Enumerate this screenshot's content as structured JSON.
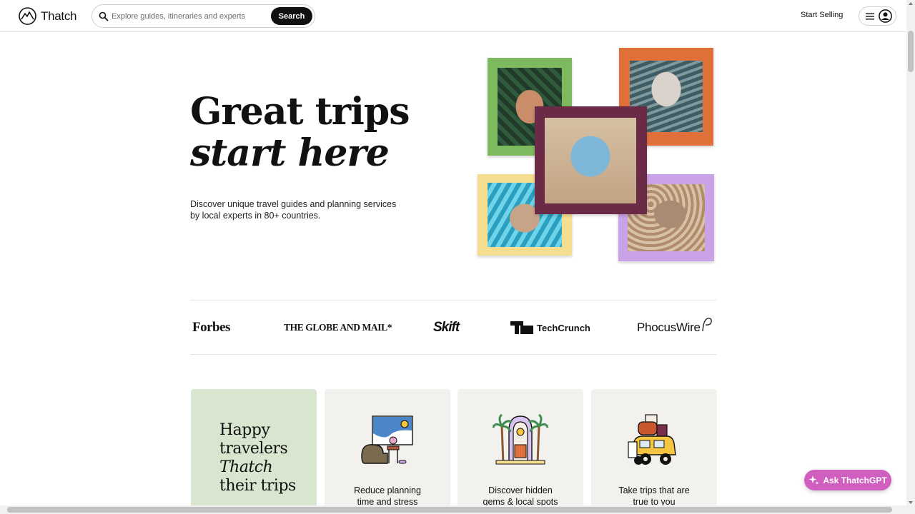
{
  "header": {
    "brand": "Thatch",
    "search_placeholder": "Explore guides, itineraries and experts",
    "search_button": "Search",
    "start_selling": "Start Selling",
    "icons": [
      "thatch-logo-icon",
      "search-icon",
      "hamburger-icon",
      "account-icon"
    ]
  },
  "hero": {
    "title_line1": "Great trips",
    "title_line2": "start here",
    "subtitle_line1": "Discover unique travel guides and planning services",
    "subtitle_line2": "by local experts in 80+ countries.",
    "photo_frame_colors": [
      "#7db95e",
      "#e0703a",
      "#6b2a45",
      "#f5de8f",
      "#c9a2e8"
    ]
  },
  "press": {
    "logos": [
      "Forbes",
      "THE GLOBE AND MAIL*",
      "Skift",
      "TechCrunch",
      "PhocusWire"
    ]
  },
  "features": {
    "lead": {
      "line1": "Happy",
      "line2": "travelers",
      "line3": "Thatch",
      "line4": "their trips"
    },
    "cards": [
      {
        "line1": "Reduce planning",
        "line2": "time and stress",
        "icon": "armchair-icon"
      },
      {
        "line1": "Discover hidden",
        "line2": "gems & local spots",
        "icon": "palm-arch-icon"
      },
      {
        "line1": "Take trips that are",
        "line2": "true to you",
        "icon": "luggage-car-icon"
      }
    ]
  },
  "assistant": {
    "label": "Ask ThatchGPT",
    "color": "#d05fbf"
  }
}
